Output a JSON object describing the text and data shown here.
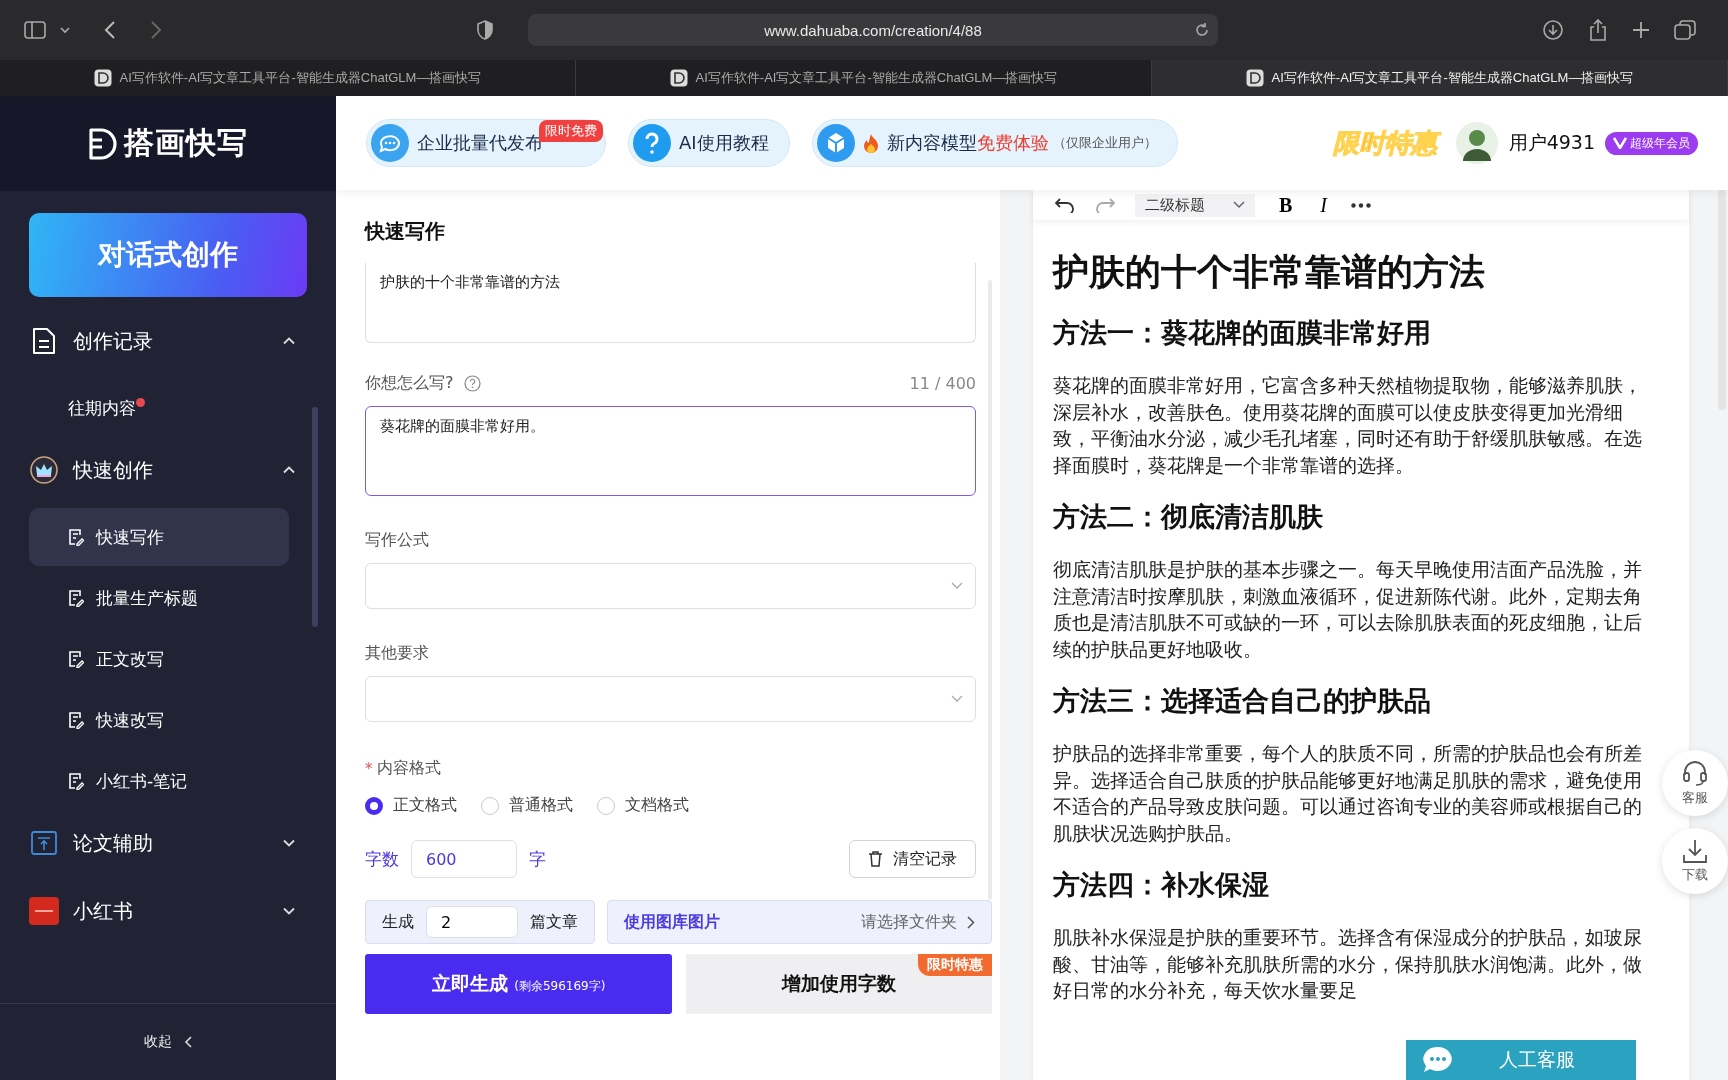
{
  "browser": {
    "url": "www.dahuaba.com/creation/4/88",
    "tabs": [
      {
        "title": "AI写作软件-AI写文章工具平台-智能生成器ChatGLM—搭画快写",
        "selected": false
      },
      {
        "title": "AI写作软件-AI写文章工具平台-智能生成器ChatGLM—搭画快写",
        "selected": false
      },
      {
        "title": "AI写作软件-AI写文章工具平台-智能生成器ChatGLM—搭画快写",
        "selected": true
      }
    ]
  },
  "sidebar": {
    "logo": "搭画快写",
    "cta": "对话式创作",
    "groups": [
      {
        "label": "创作记录",
        "expanded": true,
        "children": [
          {
            "label": "往期内容",
            "unread": true,
            "selected": false
          }
        ]
      },
      {
        "label": "快速创作",
        "expanded": true,
        "children": [
          {
            "label": "快速写作",
            "selected": true
          },
          {
            "label": "批量生产标题",
            "selected": false
          },
          {
            "label": "正文改写",
            "selected": false
          },
          {
            "label": "快速改写",
            "selected": false
          },
          {
            "label": "小红书-笔记",
            "selected": false
          }
        ]
      },
      {
        "label": "论文辅助",
        "expanded": false
      },
      {
        "label": "小红书",
        "expanded": false
      }
    ],
    "collapse": "收起"
  },
  "header": {
    "promos": [
      {
        "kind": "chat",
        "label": "企业批量代发布",
        "badge": "限时免费"
      },
      {
        "kind": "help",
        "label": "AI使用教程"
      },
      {
        "kind": "model",
        "label": "新内容模型",
        "highlight": "免费体验",
        "note": "（仅限企业用户）"
      }
    ],
    "deal": "限时特惠",
    "user": "用户4931",
    "membership": "超级年会员"
  },
  "form": {
    "title": "快速写作",
    "topic": "护肤的十个非常靠谱的方法",
    "how_label": "你想怎么写?",
    "counter": "11 / 400",
    "how_value": "葵花牌的面膜非常好用。",
    "formula_label": "写作公式",
    "other_label": "其他要求",
    "required_mark": "*",
    "format_label": "内容格式",
    "formats": [
      {
        "label": "正文格式",
        "selected": true
      },
      {
        "label": "普通格式",
        "selected": false
      },
      {
        "label": "文档格式",
        "selected": false
      }
    ],
    "words_label": "字数",
    "words_value": "600",
    "words_unit": "字",
    "clear_button": "清空记录",
    "gen_label": "生成",
    "gen_value": "2",
    "gen_unit": "篇文章",
    "gallery_label": "使用图库图片",
    "gallery_action": "请选择文件夹",
    "submit": "立即生成",
    "remaining": "(剩余596169字)",
    "more_words": "增加使用字数",
    "more_badge": "限时特惠"
  },
  "editor": {
    "heading_select": "二级标题",
    "bold": "B",
    "italic": "I",
    "title": "护肤的十个非常靠谱的方法",
    "sections": [
      {
        "heading": "方法一：葵花牌的面膜非常好用",
        "body": "葵花牌的面膜非常好用，它富含多种天然植物提取物，能够滋养肌肤，深层补水，改善肤色。使用葵花牌的面膜可以使皮肤变得更加光滑细致，平衡油水分泌，减少毛孔堵塞，同时还有助于舒缓肌肤敏感。在选择面膜时，葵花牌是一个非常靠谱的选择。"
      },
      {
        "heading": "方法二：彻底清洁肌肤",
        "body": "彻底清洁肌肤是护肤的基本步骤之一。每天早晚使用洁面产品洗脸，并注意清洁时按摩肌肤，刺激血液循环，促进新陈代谢。此外，定期去角质也是清洁肌肤不可或缺的一环，可以去除肌肤表面的死皮细胞，让后续的护肤品更好地吸收。"
      },
      {
        "heading": "方法三：选择适合自己的护肤品",
        "body": "护肤品的选择非常重要，每个人的肤质不同，所需的护肤品也会有所差异。选择适合自己肤质的护肤品能够更好地满足肌肤的需求，避免使用不适合的产品导致皮肤问题。可以通过咨询专业的美容师或根据自己的肌肤状况选购护肤品。"
      },
      {
        "heading": "方法四：补水保湿",
        "body": "肌肤补水保湿是护肤的重要环节。选择含有保湿成分的护肤品，如玻尿酸、甘油等，能够补充肌肤所需的水分，保持肌肤水润饱满。此外，做好日常的水分补充，每天饮水量要足"
      }
    ]
  },
  "floats": [
    {
      "kind": "service",
      "label": "客服"
    },
    {
      "kind": "download",
      "label": "下载"
    }
  ],
  "chat": "人工客服"
}
